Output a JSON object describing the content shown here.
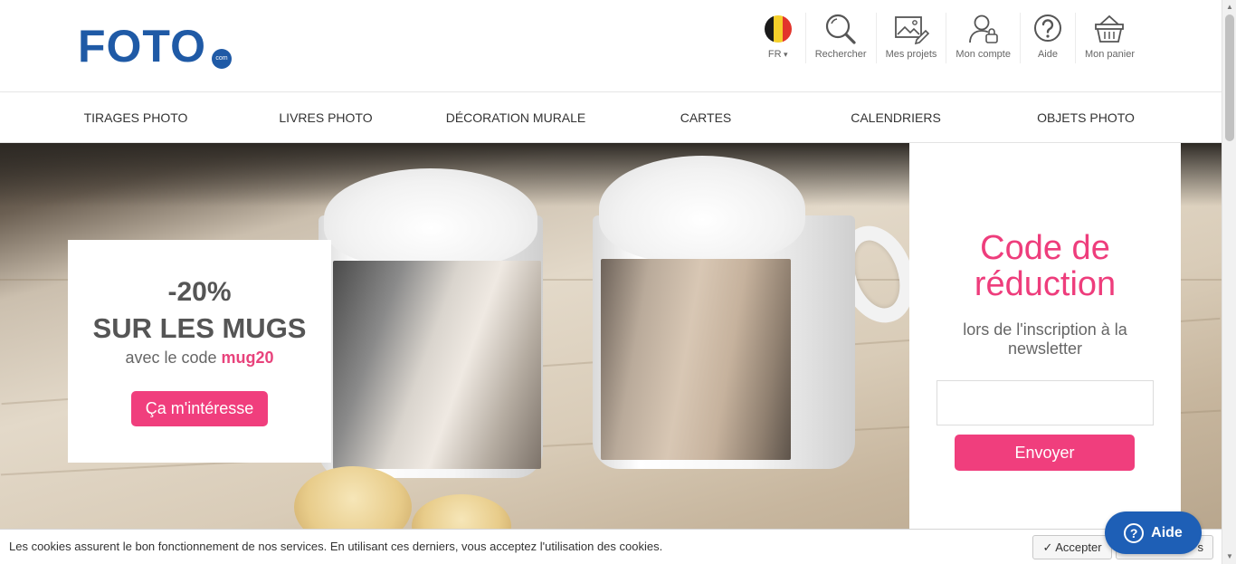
{
  "header": {
    "logo_main": "FOTO",
    "logo_suffix": "com",
    "tools": {
      "lang": {
        "label": "FR",
        "icon": "belgium-flag-icon"
      },
      "search": {
        "label": "Rechercher",
        "icon": "search-icon"
      },
      "projects": {
        "label": "Mes projets",
        "icon": "projects-icon"
      },
      "account": {
        "label": "Mon compte",
        "icon": "account-icon"
      },
      "help": {
        "label": "Aide",
        "icon": "help-icon"
      },
      "cart": {
        "label": "Mon panier",
        "icon": "basket-icon"
      }
    }
  },
  "nav": {
    "items": [
      "TIRAGES PHOTO",
      "LIVRES PHOTO",
      "DÉCORATION MURALE",
      "CARTES",
      "CALENDRIERS",
      "OBJETS PHOTO"
    ]
  },
  "promo": {
    "discount": "-20%",
    "title": "SUR LES MUGS",
    "code_prefix": "avec le code",
    "code": "mug20",
    "button": "Ça m'intéresse"
  },
  "newsletter": {
    "heading": "Code de réduction",
    "subheading": "lors de l'inscription à la newsletter",
    "email_value": "",
    "button": "Envoyer"
  },
  "cookies": {
    "message": "Les cookies assurent le bon fonctionnement de nos services. En utilisant ces derniers, vous acceptez l'utilisation des cookies.",
    "accept": "✓ Accepter",
    "more": "s"
  },
  "help_widget": {
    "label": "Aide",
    "icon": "question-icon"
  },
  "colors": {
    "brand_blue": "#1f5aa6",
    "accent_pink": "#f03e7d",
    "help_blue": "#1e5fb6"
  }
}
